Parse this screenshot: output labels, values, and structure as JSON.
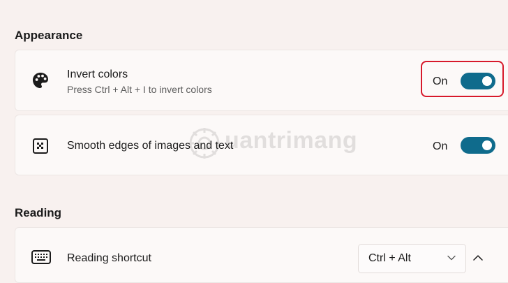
{
  "appearance": {
    "title": "Appearance",
    "invert_colors": {
      "label": "Invert colors",
      "description": "Press Ctrl + Alt + I to invert colors",
      "state": "On",
      "enabled": true,
      "icon": "palette-icon"
    },
    "smooth_edges": {
      "label": "Smooth edges of images and text",
      "state": "On",
      "enabled": true,
      "icon": "smooth-edges-icon"
    }
  },
  "reading": {
    "title": "Reading",
    "shortcut": {
      "label": "Reading shortcut",
      "value": "Ctrl + Alt",
      "icon": "keyboard-icon"
    }
  },
  "watermark": {
    "text": "uantrimang"
  },
  "colors": {
    "accent": "#0f6b8c",
    "highlight": "#d7192b",
    "background": "#f8f1ef",
    "card": "#fcf9f8"
  }
}
